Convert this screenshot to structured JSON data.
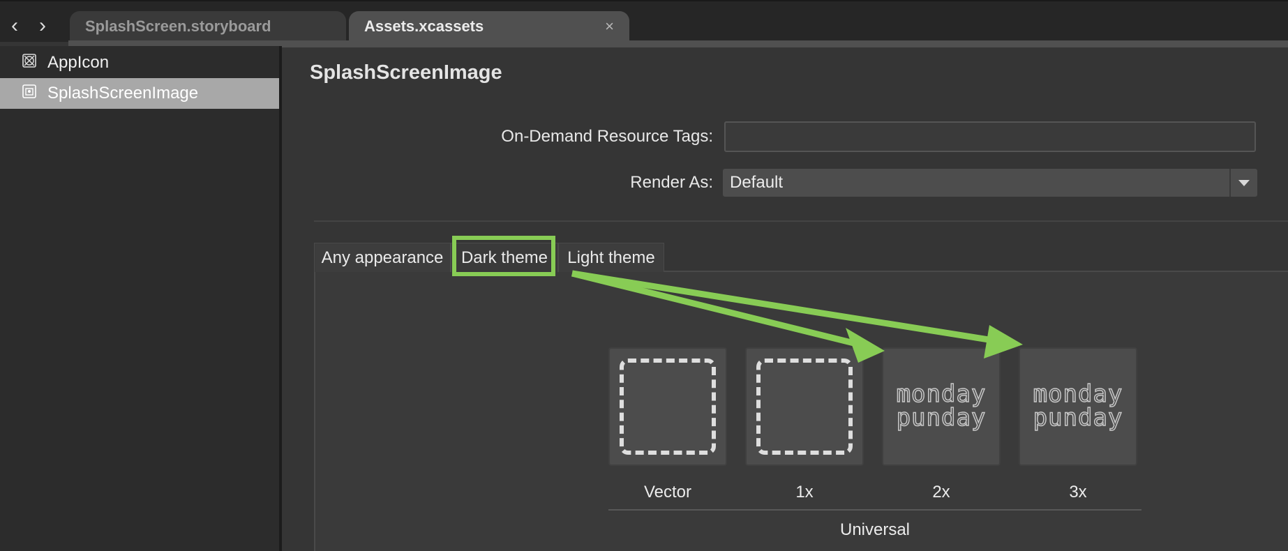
{
  "tabbar": {
    "back_icon": "chevron-left-icon",
    "forward_icon": "chevron-right-icon",
    "tabs": [
      {
        "label": "SplashScreen.storyboard",
        "active": false
      },
      {
        "label": "Assets.xcassets",
        "active": true,
        "close": "×"
      }
    ]
  },
  "sidebar": {
    "items": [
      {
        "label": "AppIcon",
        "icon": "appicon-asset-icon",
        "selected": false
      },
      {
        "label": "SplashScreenImage",
        "icon": "image-asset-icon",
        "selected": true
      }
    ]
  },
  "main": {
    "title": "SplashScreenImage",
    "tags_label": "On-Demand Resource Tags:",
    "tags_value": "",
    "render_label": "Render As:",
    "render_value": "Default",
    "appearance_tabs": [
      "Any appearance",
      "Dark theme",
      "Light theme"
    ],
    "selected_appearance": "Dark theme",
    "slots": [
      {
        "label": "Vector",
        "filled": false
      },
      {
        "label": "1x",
        "filled": false
      },
      {
        "label": "2x",
        "filled": true,
        "text_line1": "monday",
        "text_line2": "punday"
      },
      {
        "label": "3x",
        "filled": true,
        "text_line1": "monday",
        "text_line2": "punday"
      }
    ],
    "group_label": "Universal"
  },
  "annotation": {
    "color": "#88cc55"
  }
}
